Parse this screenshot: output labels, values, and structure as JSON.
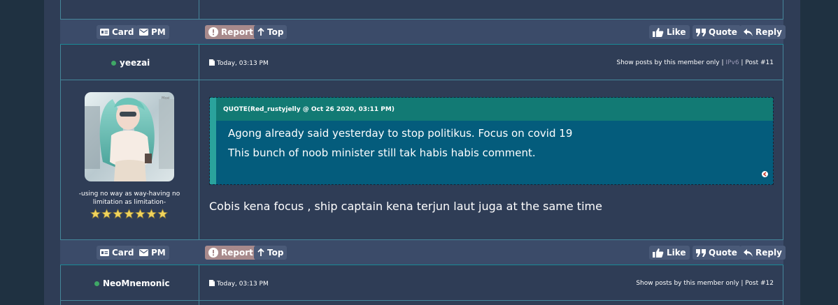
{
  "controls": {
    "card": "Card",
    "pm": "PM",
    "report": "Report",
    "top": "Top",
    "like": "Like",
    "quote": "Quote",
    "reply": "Reply"
  },
  "posts": [
    {
      "username": "yeezai",
      "time": "Today, 03:13 PM",
      "meta_prefix": "Show posts by this member only |",
      "meta_ip": "IPv6",
      "meta_suffix": "| Post #11",
      "tagline": "-using no way as way-having no limitation as limitation-",
      "stars": 7,
      "quote": {
        "header": "QUOTE(Red_rustyjelly @ Oct 26 2020, 03:11 PM)",
        "lines": [
          "Agong already said yesterday to stop politikus. Focus on covid 19",
          "This bunch of noob minister still tak habis habis comment."
        ]
      },
      "body": "Cobis kena focus , ship captain kena terjun laut juga at the same time"
    },
    {
      "username": "NeoMnemonic",
      "time": "Today, 03:13 PM",
      "meta": "Show posts by this member only | Post #12"
    }
  ],
  "colors": {
    "page_bg": "#1f3141",
    "panel_bg": "#2f3d56",
    "bar_bg": "#3b4b69",
    "button_bg": "#4a5a78",
    "report_bg": "#a88a8c",
    "quote_bg": "#045c7c",
    "quote_header_bg": "#127a74",
    "online_dot": "#3fa866",
    "divider": "#45869a"
  },
  "icons": [
    "card-icon",
    "mail-icon",
    "alert-icon",
    "arrow-up-icon",
    "thumbs-up-icon",
    "quote-icon",
    "reply-icon",
    "document-icon",
    "star-icon",
    "collapse-icon"
  ]
}
